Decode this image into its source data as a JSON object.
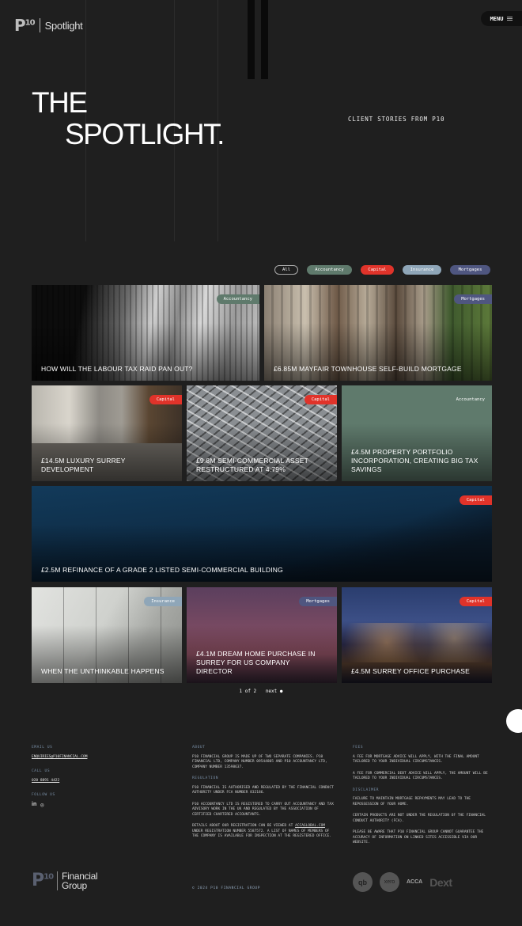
{
  "header": {
    "logo_mark": "P",
    "logo_sup": "10",
    "logo_text": "Spotlight",
    "menu_label": "MENU"
  },
  "hero": {
    "title_line1": "THE",
    "title_line2": "SPOTLIGHT.",
    "subtitle": "CLIENT STORIES FROM P10"
  },
  "filters": [
    {
      "label": "All",
      "color": "#1f1f1f"
    },
    {
      "label": "Accountancy",
      "color": "#5f7a6c"
    },
    {
      "label": "Capital",
      "color": "#e0332a"
    },
    {
      "label": "Insurance",
      "color": "#8fa6b8"
    },
    {
      "label": "Mortgages",
      "color": "#4f5680"
    }
  ],
  "cards": [
    {
      "title": "HOW WILL THE LABOUR TAX RAID PAN OUT?",
      "tag": "Accountancy",
      "tag_color": "#5f7a6c"
    },
    {
      "title": "£6.85M MAYFAIR TOWNHOUSE SELF-BUILD MORTGAGE",
      "tag": "Mortgages",
      "tag_color": "#4f5680"
    },
    {
      "title": "£14.5M LUXURY SURREY DEVELOPMENT",
      "tag": "Capital",
      "tag_color": "#e0332a"
    },
    {
      "title": "£9.8M SEMI-COMMERCIAL ASSET RESTRUCTURED AT 4.79%",
      "tag": "Capital",
      "tag_color": "#e0332a"
    },
    {
      "title": "£4.5M PROPERTY PORTFOLIO INCORPORATION, CREATING BIG TAX SAVINGS",
      "tag": "Accountancy",
      "tag_color": "#5f7a6c"
    },
    {
      "title": "£2.5M REFINANCE OF A GRADE 2 LISTED SEMI-COMMERCIAL BUILDING",
      "tag": "Capital",
      "tag_color": "#e0332a"
    },
    {
      "title": "WHEN THE UNTHINKABLE HAPPENS",
      "tag": "Insurance",
      "tag_color": "#8fa6b8"
    },
    {
      "title": "£4.1M DREAM HOME PURCHASE IN SURREY FOR US COMPANY DIRECTOR",
      "tag": "Mortgages",
      "tag_color": "#4f5680"
    },
    {
      "title": "£4.5M SURREY OFFICE PURCHASE",
      "tag": "Capital",
      "tag_color": "#e0332a"
    }
  ],
  "pager": {
    "current": "1 of 2",
    "next": "next ●"
  },
  "footer": {
    "email_label": "EMAIL US",
    "email": "ENQUIRIES@P10FINANCIAL.COM",
    "call_label": "CALL US",
    "phone": "020 8891 4422",
    "follow_label": "FOLLOW US",
    "social": [
      "in",
      "◎"
    ],
    "about_label": "ABOUT",
    "about_text": "P10 FINANCIAL GROUP IS MADE UP OF TWO SEPARATE COMPANIES. P10 FINANCIAL LTD, COMPANY NUMBER 09544805 AND P10 ACCOUNTANCY LTD, COMPANY NUMBER 13598637.",
    "regulation_label": "REGULATION",
    "regulation_1": "P10 FINANCIAL IS AUTHORISED AND REGULATED BY THE FINANCIAL CONDUCT AUTHORITY UNDER FCA NUMBER 832186.",
    "regulation_2": "P10 ACCOUNTANCY LTD IS REGISTERED TO CARRY OUT ACCOUNTANCY AND TAX ADVISORY WORK IN THE UK AND REGULATED BY THE ASSOCIATION OF CERTIFIED CHARTERED ACCOUNTANTS.",
    "regulation_3a": "DETAILS ABOUT OUR REGISTRATION CAN BE VIEWED AT",
    "regulation_3link": "ACCAGLOBAL.COM",
    "regulation_3b": "UNDER REGISTRATION NUMBER 5587572. A LIST OF NAMES OF MEMBERS OF THE COMPANY IS AVAILABLE FOR INSPECTION AT THE REGISTERED OFFICE.",
    "fees_label": "FEES",
    "fees_1": "A FEE FOR MORTGAGE ADVICE WILL APPLY, WITH THE FINAL AMOUNT TAILORED TO YOUR INDIVIDUAL CIRCUMSTANCES.",
    "fees_2": "A FEE FOR COMMERCIAL DEBT ADVICE WILL APPLY, THE AMOUNT WILL BE TAILORED TO YOUR INDIVIDUAL CIRCUMSTANCES.",
    "disclaimer_label": "DISCLAIMER",
    "disclaimer_1": "FAILURE TO MAINTAIN MORTGAGE REPAYMENTS MAY LEAD TO THE REPOSSESSION OF YOUR HOME.",
    "disclaimer_2": "CERTAIN PRODUCTS ARE NOT UNDER THE REGULATION OF THE FINANCIAL CONDUCT AUTHORITY (FCA).",
    "disclaimer_3": "PLEASE BE AWARE THAT P10 FINANCIAL GROUP CANNOT GUARANTEE THE ACCURACY OF INFORMATION ON LINKED SITES ACCESSIBLE VIA OUR WEBSITE.",
    "logo_mark": "P",
    "logo_sup": "10",
    "logo_line1": "Financial",
    "logo_line2": "Group",
    "copyright": "© 2024 P10 FINANCIAL GROUP",
    "partners": [
      "qb",
      "xero",
      "ACCA",
      "Dext"
    ]
  }
}
